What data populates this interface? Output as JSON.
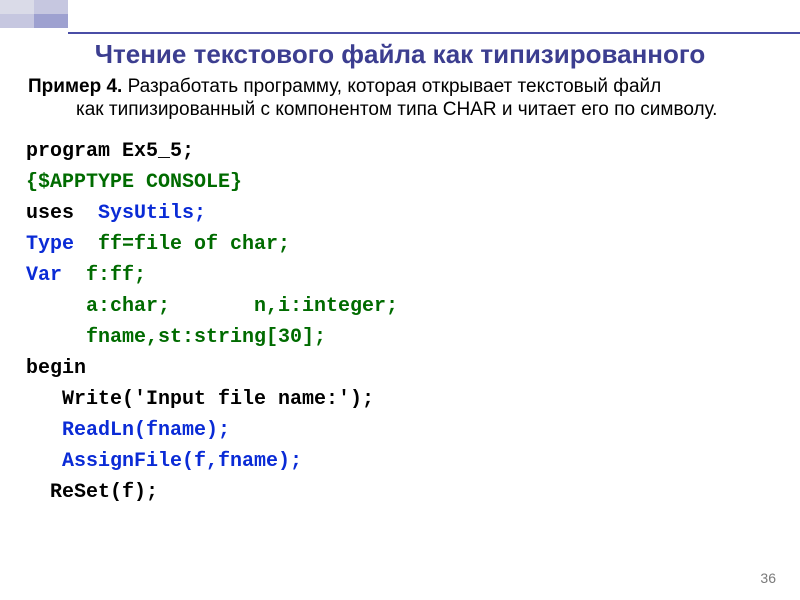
{
  "title": "Чтение текстового файла как типизированного",
  "example_label": "Пример 4.",
  "example_text_first": " Разработать программу, которая открывает текстовый файл",
  "example_text_rest": "как типизированный с компонентом типа CHAR и читает его по символу.",
  "code": {
    "l1": "program Ex5_5;",
    "l2": "{$APPTYPE CONSOLE}",
    "l3a": "uses  ",
    "l3b": "SysUtils;",
    "l4a": "Type  ",
    "l4b": "ff=file of char;",
    "l5a": "Var  ",
    "l5b": "f:ff;",
    "l6": "     a:char;       n,i:integer;",
    "l7": "     fname,st:string[30];",
    "l8": "begin",
    "l9": "   Write('Input file name:');",
    "l10": "   ReadLn(fname);",
    "l11": "   AssignFile(f,fname);",
    "l12": "  ReSet(f);"
  },
  "page_number": "36"
}
